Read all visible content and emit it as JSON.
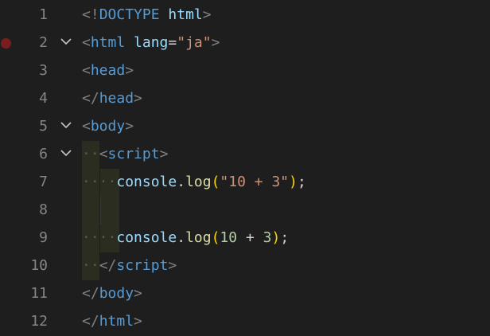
{
  "editor": {
    "line_numbers": [
      "1",
      "2",
      "3",
      "4",
      "5",
      "6",
      "7",
      "8",
      "9",
      "10",
      "11",
      "12"
    ],
    "l1": {
      "open": "<!",
      "doctype": "DOCTYPE",
      "sp": " ",
      "html": "html",
      "close": ">"
    },
    "l2": {
      "open": "<",
      "tag": "html",
      "sp": " ",
      "attr": "lang",
      "eq": "=",
      "val": "\"ja\"",
      "close": ">"
    },
    "l3": {
      "open": "<",
      "tag": "head",
      "close": ">"
    },
    "l4": {
      "open": "</",
      "tag": "head",
      "close": ">"
    },
    "l5": {
      "open": "<",
      "tag": "body",
      "close": ">"
    },
    "l6": {
      "indent": "··",
      "open": "<",
      "tag": "script",
      "close": ">"
    },
    "l7": {
      "indent": "····",
      "obj": "console",
      "dot": ".",
      "fn": "log",
      "lp": "(",
      "str": "\"10 + 3\"",
      "rp": ")",
      "semi": ";"
    },
    "l9": {
      "indent": "····",
      "obj": "console",
      "dot": ".",
      "fn": "log",
      "lp": "(",
      "n1": "10",
      "op": " + ",
      "n2": "3",
      "rp": ")",
      "semi": ";"
    },
    "l10": {
      "indent": "··",
      "open": "</",
      "tag": "script",
      "close": ">"
    },
    "l11": {
      "open": "</",
      "tag": "body",
      "close": ">"
    },
    "l12": {
      "open": "</",
      "tag": "html",
      "close": ">"
    }
  }
}
